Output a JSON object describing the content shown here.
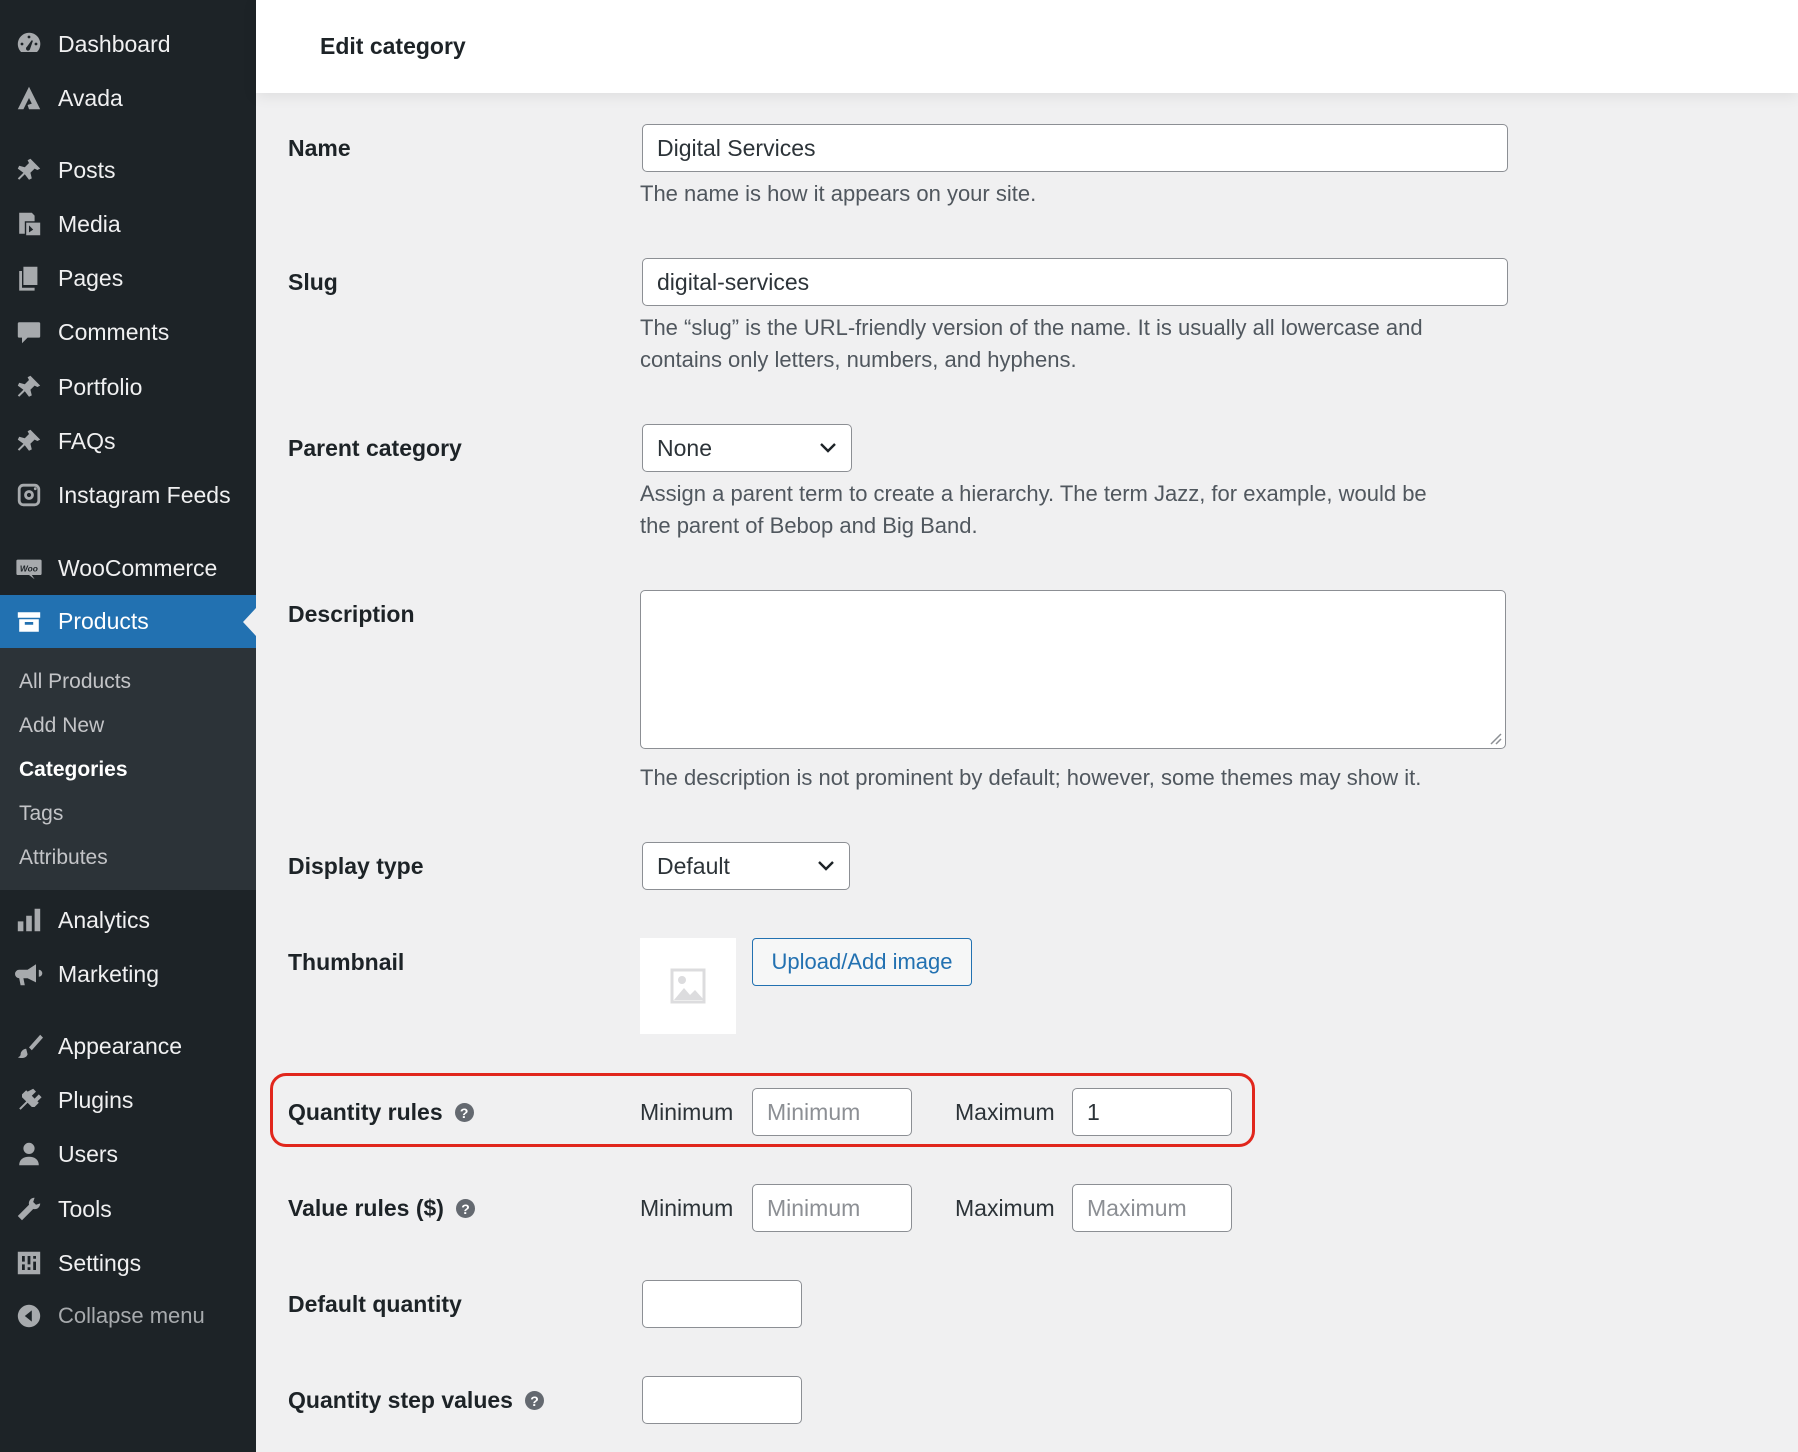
{
  "sidebar": {
    "menu": [
      {
        "label": "Dashboard",
        "icon": "dashboard-icon"
      },
      {
        "label": "Avada",
        "icon": "avada-icon"
      },
      {
        "label": "Posts",
        "icon": "pin-icon"
      },
      {
        "label": "Media",
        "icon": "media-icon"
      },
      {
        "label": "Pages",
        "icon": "pages-icon"
      },
      {
        "label": "Comments",
        "icon": "comment-icon"
      },
      {
        "label": "Portfolio",
        "icon": "pin-icon"
      },
      {
        "label": "FAQs",
        "icon": "pin-icon"
      },
      {
        "label": "Instagram Feeds",
        "icon": "instagram-icon"
      },
      {
        "label": "WooCommerce",
        "icon": "woo-icon"
      },
      {
        "label": "Products",
        "icon": "archive-icon",
        "active": true
      },
      {
        "label": "Analytics",
        "icon": "chart-bar-icon"
      },
      {
        "label": "Marketing",
        "icon": "megaphone-icon"
      },
      {
        "label": "Appearance",
        "icon": "paintbrush-icon"
      },
      {
        "label": "Plugins",
        "icon": "plug-icon"
      },
      {
        "label": "Users",
        "icon": "user-icon"
      },
      {
        "label": "Tools",
        "icon": "wrench-icon"
      },
      {
        "label": "Settings",
        "icon": "settings-icon"
      }
    ],
    "submenu": [
      {
        "label": "All Products"
      },
      {
        "label": "Add New"
      },
      {
        "label": "Categories",
        "current": true
      },
      {
        "label": "Tags"
      },
      {
        "label": "Attributes"
      }
    ],
    "collapse_label": "Collapse menu"
  },
  "header": {
    "title": "Edit category"
  },
  "form": {
    "name": {
      "label": "Name",
      "value": "Digital Services",
      "description": "The name is how it appears on your site."
    },
    "slug": {
      "label": "Slug",
      "value": "digital-services",
      "description_line1": "The “slug” is the URL-friendly version of the name. It is usually all lowercase and",
      "description_line2": "contains only letters, numbers, and hyphens."
    },
    "parent": {
      "label": "Parent category",
      "selected": "None",
      "description_line1": "Assign a parent term to create a hierarchy. The term Jazz, for example, would be",
      "description_line2": "the parent of Bebop and Big Band."
    },
    "description": {
      "label": "Description",
      "value": "",
      "description": "The description is not prominent by default; however, some themes may show it."
    },
    "display_type": {
      "label": "Display type",
      "selected": "Default"
    },
    "thumbnail": {
      "label": "Thumbnail",
      "upload_label": "Upload/Add image"
    },
    "quantity_rules": {
      "label": "Quantity rules",
      "min_label": "Minimum",
      "min_placeholder": "Minimum",
      "min_value": "",
      "max_label": "Maximum",
      "max_placeholder": "Maximum",
      "max_value": "1",
      "highlight_color": "#e1261c"
    },
    "value_rules": {
      "label": "Value rules ($)",
      "min_label": "Minimum",
      "min_placeholder": "Minimum",
      "max_label": "Maximum",
      "max_placeholder": "Maximum"
    },
    "default_quantity": {
      "label": "Default quantity",
      "value": ""
    },
    "step_values": {
      "label": "Quantity step values",
      "value": ""
    },
    "help_glyph": "?"
  },
  "colors": {
    "sidebar_bg": "#1d2327",
    "active_bg": "#2271b1",
    "submenu_bg": "#2c3338",
    "accent": "#2271b1"
  }
}
